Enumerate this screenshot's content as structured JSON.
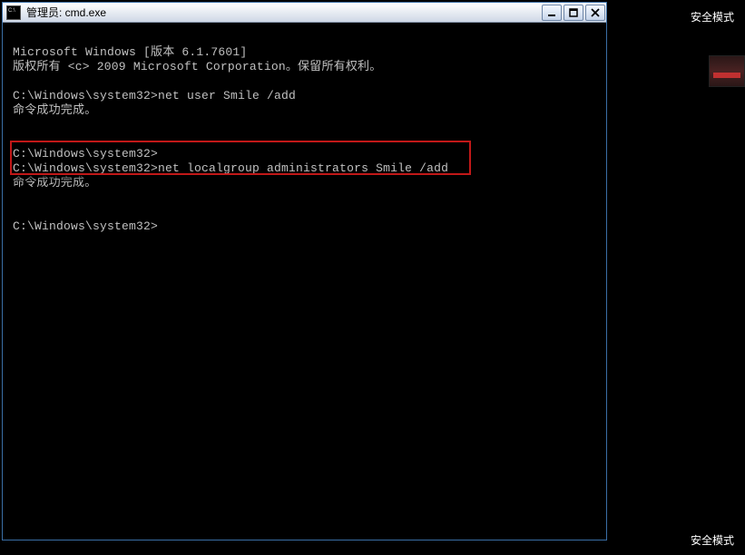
{
  "desktop": {
    "safe_mode_top": "安全模式",
    "safe_mode_bottom": "安全模式"
  },
  "window": {
    "title": "管理员: cmd.exe"
  },
  "terminal": {
    "prompt": "C:\\Windows\\system32>",
    "lines": {
      "0": "Microsoft Windows [版本 6.1.7601]",
      "1": "版权所有 <c> 2009 Microsoft Corporation。保留所有权利。",
      "2": "",
      "3p": "C:\\Windows\\system32>",
      "3c": "net user Smile /add",
      "4": "命令成功完成。",
      "5": "",
      "6": "",
      "7": "C:\\Windows\\system32>",
      "8p": "C:\\Windows\\system32>",
      "8c": "net localgroup administrators Smile /add",
      "9": "命令成功完成。",
      "10": "",
      "11": "",
      "12": "C:\\Windows\\system32>"
    },
    "highlighted_command": "net localgroup administrators Smile /add"
  },
  "colors": {
    "highlight_border": "#c11818",
    "titlebar_gradient_top": "#ffffff",
    "titlebar_gradient_bottom": "#cfd8e6",
    "window_border": "#3a6ea5",
    "terminal_bg": "#000000",
    "terminal_fg": "#c0c0c0"
  }
}
